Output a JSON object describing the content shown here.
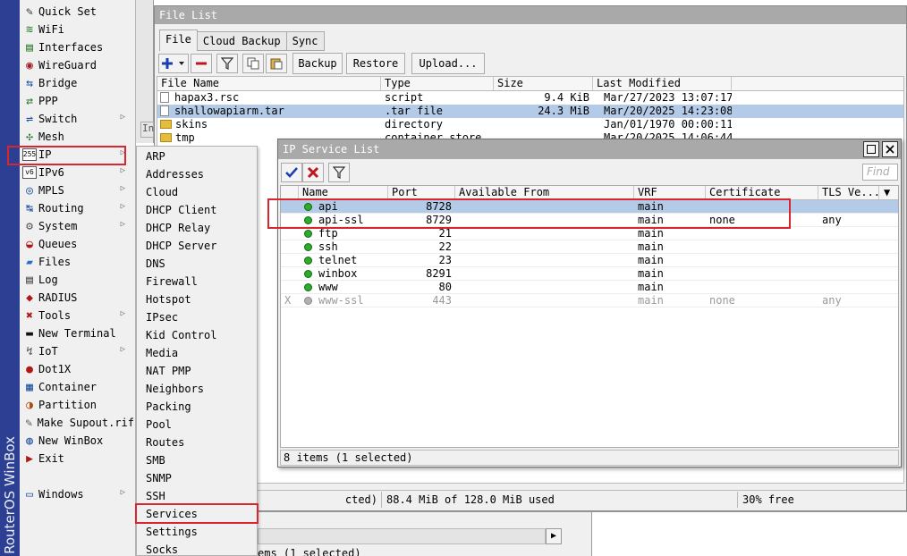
{
  "brand": "RouterOS WinBox",
  "sidebar": {
    "items": [
      {
        "label": "Quick Set",
        "icon": "wand-icon",
        "arrow": false
      },
      {
        "label": "WiFi",
        "icon": "wifi-icon",
        "arrow": false
      },
      {
        "label": "Interfaces",
        "icon": "interfaces-icon",
        "arrow": false
      },
      {
        "label": "WireGuard",
        "icon": "wireguard-icon",
        "arrow": false
      },
      {
        "label": "Bridge",
        "icon": "bridge-icon",
        "arrow": false
      },
      {
        "label": "PPP",
        "icon": "ppp-icon",
        "arrow": false
      },
      {
        "label": "Switch",
        "icon": "switch-icon",
        "arrow": true
      },
      {
        "label": "Mesh",
        "icon": "mesh-icon",
        "arrow": false
      },
      {
        "label": "IP",
        "icon": "ip-icon",
        "arrow": true
      },
      {
        "label": "IPv6",
        "icon": "ipv6-icon",
        "arrow": true
      },
      {
        "label": "MPLS",
        "icon": "mpls-icon",
        "arrow": true
      },
      {
        "label": "Routing",
        "icon": "routing-icon",
        "arrow": true
      },
      {
        "label": "System",
        "icon": "gear-icon",
        "arrow": true
      },
      {
        "label": "Queues",
        "icon": "queues-icon",
        "arrow": false
      },
      {
        "label": "Files",
        "icon": "folder-icon",
        "arrow": false
      },
      {
        "label": "Log",
        "icon": "log-icon",
        "arrow": false
      },
      {
        "label": "RADIUS",
        "icon": "radius-icon",
        "arrow": false
      },
      {
        "label": "Tools",
        "icon": "tools-icon",
        "arrow": true
      },
      {
        "label": "New Terminal",
        "icon": "terminal-icon",
        "arrow": false
      },
      {
        "label": "IoT",
        "icon": "iot-icon",
        "arrow": true
      },
      {
        "label": "Dot1X",
        "icon": "dot1x-icon",
        "arrow": false
      },
      {
        "label": "Container",
        "icon": "container-icon",
        "arrow": false
      },
      {
        "label": "Partition",
        "icon": "partition-icon",
        "arrow": false
      },
      {
        "label": "Make Supout.rif",
        "icon": "supout-icon",
        "arrow": false
      },
      {
        "label": "New WinBox",
        "icon": "winbox-icon",
        "arrow": false
      },
      {
        "label": "Exit",
        "icon": "exit-icon",
        "arrow": false
      },
      {
        "label": "Windows",
        "icon": "windows-icon",
        "arrow": true
      }
    ]
  },
  "gap_tab": "In",
  "ip_submenu": {
    "items": [
      "ARP",
      "Addresses",
      "Cloud",
      "DHCP Client",
      "DHCP Relay",
      "DHCP Server",
      "DNS",
      "Firewall",
      "Hotspot",
      "IPsec",
      "Kid Control",
      "Media",
      "NAT PMP",
      "Neighbors",
      "Packing",
      "Pool",
      "Routes",
      "SMB",
      "SNMP",
      "SSH",
      "Services",
      "Settings",
      "Socks"
    ],
    "selected": "Services"
  },
  "file_list": {
    "title": "File List",
    "tabs": [
      "File",
      "Cloud Backup",
      "Sync"
    ],
    "toolbar": {
      "backup": "Backup",
      "restore": "Restore",
      "upload": "Upload..."
    },
    "columns": [
      "File Name",
      "Type",
      "Size",
      "Last Modified"
    ],
    "rows": [
      {
        "name": "hapax3.rsc",
        "type": "script",
        "size": "9.4 KiB",
        "modified": "Mar/27/2023 13:07:17",
        "kind": "file"
      },
      {
        "name": "shallowapiarm.tar",
        "type": ".tar file",
        "size": "24.3 MiB",
        "modified": "Mar/20/2025 14:23:08",
        "kind": "file"
      },
      {
        "name": "skins",
        "type": "directory",
        "size": "",
        "modified": "Jan/01/1970 00:00:11",
        "kind": "folder"
      },
      {
        "name": "tmp",
        "type": "container store",
        "size": "",
        "modified": "Mar/20/2025 14:06:44",
        "kind": "folder"
      }
    ],
    "status": {
      "items": "cted)",
      "usage": "88.4 MiB of 128.0 MiB used",
      "free": "30% free"
    }
  },
  "bottom_panel": {
    "status": "ems (1 selected)"
  },
  "ip_service_list": {
    "title": "IP Service List",
    "find_placeholder": "Find",
    "columns": [
      "Name",
      "Port",
      "Available From",
      "VRF",
      "Certificate",
      "TLS Ve..."
    ],
    "rows": [
      {
        "flag": "",
        "name": "api",
        "port": "8728",
        "from": "",
        "vrf": "main",
        "cert": "",
        "tls": "",
        "enabled": true
      },
      {
        "flag": "",
        "name": "api-ssl",
        "port": "8729",
        "from": "",
        "vrf": "main",
        "cert": "none",
        "tls": "any",
        "enabled": true
      },
      {
        "flag": "",
        "name": "ftp",
        "port": "21",
        "from": "",
        "vrf": "main",
        "cert": "",
        "tls": "",
        "enabled": true
      },
      {
        "flag": "",
        "name": "ssh",
        "port": "22",
        "from": "",
        "vrf": "main",
        "cert": "",
        "tls": "",
        "enabled": true
      },
      {
        "flag": "",
        "name": "telnet",
        "port": "23",
        "from": "",
        "vrf": "main",
        "cert": "",
        "tls": "",
        "enabled": true
      },
      {
        "flag": "",
        "name": "winbox",
        "port": "8291",
        "from": "",
        "vrf": "main",
        "cert": "",
        "tls": "",
        "enabled": true
      },
      {
        "flag": "",
        "name": "www",
        "port": "80",
        "from": "",
        "vrf": "main",
        "cert": "",
        "tls": "",
        "enabled": true
      },
      {
        "flag": "X",
        "name": "www-ssl",
        "port": "443",
        "from": "",
        "vrf": "main",
        "cert": "none",
        "tls": "any",
        "enabled": false
      }
    ],
    "status": "8 items (1 selected)"
  },
  "colors": {
    "highlight": "#d9252e",
    "selection": "#b3cbe6",
    "brand_bar": "#2d3f92",
    "titlebar": "#a9a9a9"
  }
}
